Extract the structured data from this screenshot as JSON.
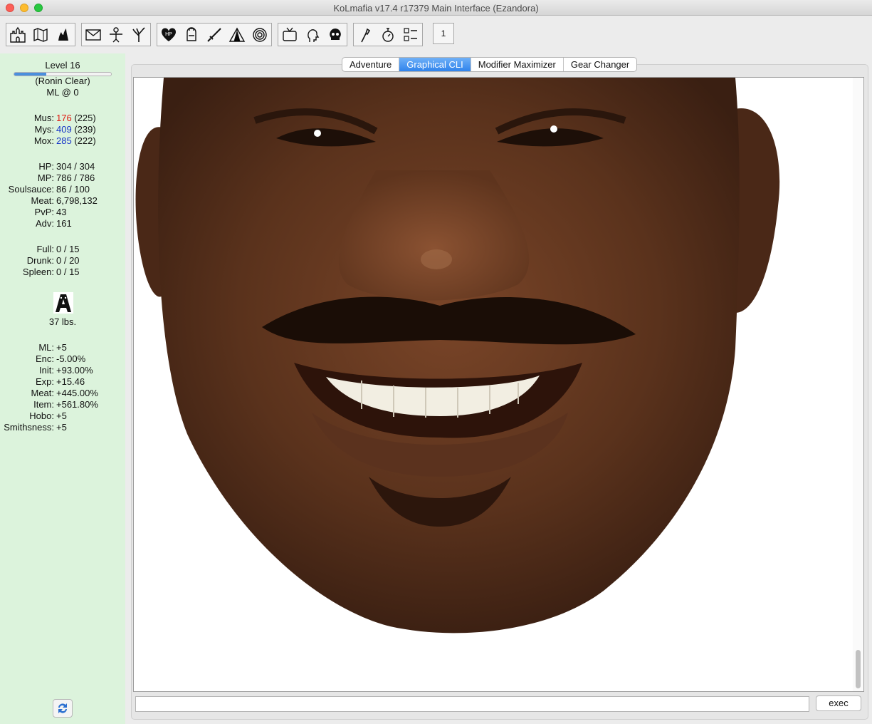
{
  "window": {
    "title": "KoLmafia v17.4 r17379 Main Interface (Ezandora)"
  },
  "toolbar": {
    "groups": [
      [
        "castle-icon",
        "map-icon",
        "cauldron-icon"
      ],
      [
        "mail-icon",
        "scarecrow-icon",
        "tree-icon"
      ],
      [
        "hp-heart-icon",
        "backpack-icon",
        "sword-icon",
        "circus-tent-icon",
        "spiral-icon"
      ],
      [
        "tv-icon",
        "head-icon",
        "skull-icon"
      ],
      [
        "torch-icon",
        "stopwatch-icon",
        "checklist-icon"
      ]
    ],
    "hp_label": "HP",
    "badge": "1"
  },
  "sidebar": {
    "level": "Level 16",
    "xp_progress": 0.33,
    "path": "(Ronin Clear)",
    "ml": "ML @ 0",
    "stats": [
      {
        "label": "Mus:",
        "value": "176",
        "base": "(225)",
        "color": "red"
      },
      {
        "label": "Mys:",
        "value": "409",
        "base": "(239)",
        "color": "blue"
      },
      {
        "label": "Mox:",
        "value": "285",
        "base": "(222)",
        "color": "blue"
      }
    ],
    "resources": [
      {
        "label": "HP:",
        "value": "304 / 304"
      },
      {
        "label": "MP:",
        "value": "786 / 786"
      },
      {
        "label": "Soulsauce:",
        "value": "86 / 100"
      },
      {
        "label": "Meat:",
        "value": "6,798,132"
      },
      {
        "label": "PvP:",
        "value": "43"
      },
      {
        "label": "Adv:",
        "value": "161"
      }
    ],
    "organs": [
      {
        "label": "Full:",
        "value": "0 / 15"
      },
      {
        "label": "Drunk:",
        "value": "0 / 20"
      },
      {
        "label": "Spleen:",
        "value": "0 / 15"
      }
    ],
    "familiar_weight": "37 lbs.",
    "modifiers": [
      {
        "label": "ML:",
        "value": "+5"
      },
      {
        "label": "Enc:",
        "value": "-5.00%"
      },
      {
        "label": "Init:",
        "value": "+93.00%"
      },
      {
        "label": "Exp:",
        "value": "+15.46"
      },
      {
        "label": "Meat:",
        "value": "+445.00%"
      },
      {
        "label": "Item:",
        "value": "+561.80%"
      },
      {
        "label": "Hobo:",
        "value": "+5"
      },
      {
        "label": "Smithsness:",
        "value": "+5"
      }
    ]
  },
  "tabs": [
    "Adventure",
    "Graphical CLI",
    "Modifier Maximizer",
    "Gear Changer"
  ],
  "active_tab": 1,
  "cli": {
    "input_value": "",
    "exec_label": "exec"
  },
  "colors": {
    "sidebar_bg": "#dcf3dc",
    "active_tab": "#2f83ec",
    "stat_buffed_down": "#e0190f",
    "stat_buffed_up": "#1533c8"
  }
}
